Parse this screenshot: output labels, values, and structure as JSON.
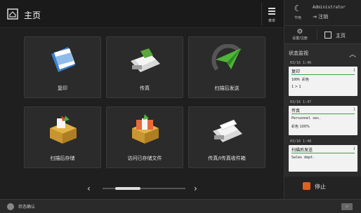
{
  "header": {
    "title": "主页",
    "menu_label": "菜单"
  },
  "tiles": [
    {
      "label": "复印",
      "icon": "copy-icon"
    },
    {
      "label": "传真",
      "icon": "fax-icon"
    },
    {
      "label": "扫描后发送",
      "icon": "scan-send-icon"
    },
    {
      "label": "扫描后存储",
      "icon": "scan-store-icon"
    },
    {
      "label": "访问已存储文件",
      "icon": "stored-files-icon"
    },
    {
      "label": "传真/I传真收件箱",
      "icon": "fax-inbox-icon"
    }
  ],
  "pager": {
    "prev": "‹",
    "next": "›",
    "position": 0.2
  },
  "right_panel": {
    "energy_label": "节电",
    "user": "Administrator",
    "logout": "注销",
    "settings_label": "设置/注册",
    "home_label": "主页",
    "monitor_title": "状态监视",
    "jobs": [
      {
        "time": "03/16 1:46",
        "title": "复印",
        "line2": "100%   彩色",
        "line3": "1 > 1"
      },
      {
        "time": "03/16 1:47",
        "title": "传真",
        "line2": "Personnel sec.",
        "line3": "彩色   100%"
      },
      {
        "time": "03/16 1:48",
        "title": "扫描后发送",
        "line2": "Sales dept.",
        "line3": ""
      }
    ],
    "stop_label": "停止"
  },
  "status_bar": {
    "text": "状态确认",
    "right": "▭"
  },
  "colors": {
    "accent_stop": "#e06020",
    "job_bar": "#3aa04a"
  }
}
